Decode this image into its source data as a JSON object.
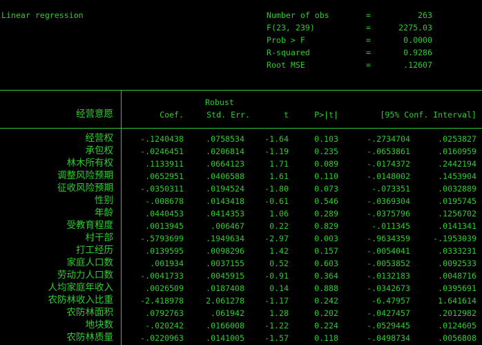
{
  "header": {
    "model_title": "Linear regression",
    "stats": [
      {
        "label": "Number of obs",
        "eq": "=",
        "value": "263"
      },
      {
        "label": "F(23, 239)",
        "eq": "=",
        "value": "2275.03"
      },
      {
        "label": "Prob > F",
        "eq": "=",
        "value": "0.0000"
      },
      {
        "label": "R-squared",
        "eq": "=",
        "value": "0.9286"
      },
      {
        "label": "Root MSE",
        "eq": "=",
        "value": ".12607"
      }
    ]
  },
  "table": {
    "robust_label": "Robust",
    "depvar": "经营意愿",
    "columns": [
      "Coef.",
      "Std. Err.",
      "t",
      "P>|t|",
      "[95% Conf. Interval]"
    ],
    "rows": [
      {
        "name": "经营权",
        "coef": "-.1240438",
        "se": ".0758534",
        "t": "-1.64",
        "p": "0.103",
        "lo": "-.2734704",
        "hi": ".0253827"
      },
      {
        "name": "承包权",
        "coef": "-.0246451",
        "se": ".0206814",
        "t": "-1.19",
        "p": "0.235",
        "lo": "-.0653861",
        "hi": ".0160959"
      },
      {
        "name": "林木所有权",
        "coef": ".1133911",
        "se": ".0664123",
        "t": "1.71",
        "p": "0.089",
        "lo": "-.0174372",
        "hi": ".2442194"
      },
      {
        "name": "调整风险预期",
        "coef": ".0652951",
        "se": ".0406588",
        "t": "1.61",
        "p": "0.110",
        "lo": "-.0148002",
        "hi": ".1453904"
      },
      {
        "name": "征收风险预期",
        "coef": "-.0350311",
        "se": ".0194524",
        "t": "-1.80",
        "p": "0.073",
        "lo": "-.073351",
        "hi": ".0032889"
      },
      {
        "name": "性别",
        "coef": "-.008678",
        "se": ".0143418",
        "t": "-0.61",
        "p": "0.546",
        "lo": "-.0369304",
        "hi": ".0195745"
      },
      {
        "name": "年龄",
        "coef": ".0440453",
        "se": ".0414353",
        "t": "1.06",
        "p": "0.289",
        "lo": "-.0375796",
        "hi": ".1256702"
      },
      {
        "name": "受教育程度",
        "coef": ".0013945",
        "se": ".006467",
        "t": "0.22",
        "p": "0.829",
        "lo": "-.011345",
        "hi": ".0141341"
      },
      {
        "name": "村干部",
        "coef": "-.5793699",
        "se": ".1949634",
        "t": "-2.97",
        "p": "0.003",
        "lo": "-.9634359",
        "hi": "-.1953039"
      },
      {
        "name": "打工经历",
        "coef": ".0139595",
        "se": ".0098296",
        "t": "1.42",
        "p": "0.157",
        "lo": "-.0054041",
        "hi": ".0333231"
      },
      {
        "name": "家庭人口数",
        "coef": ".001934",
        "se": ".0037155",
        "t": "0.52",
        "p": "0.603",
        "lo": "-.0053852",
        "hi": ".0092533"
      },
      {
        "name": "劳动力人口数",
        "coef": "-.0041733",
        "se": ".0045915",
        "t": "-0.91",
        "p": "0.364",
        "lo": "-.0132183",
        "hi": ".0048716"
      },
      {
        "name": "人均家庭年收入",
        "coef": ".0026509",
        "se": ".0187408",
        "t": "0.14",
        "p": "0.888",
        "lo": "-.0342673",
        "hi": ".0395691"
      },
      {
        "name": "农防林收入比重",
        "coef": "-2.418978",
        "se": "2.061278",
        "t": "-1.17",
        "p": "0.242",
        "lo": "-6.47957",
        "hi": "1.641614"
      },
      {
        "name": "农防林面积",
        "coef": ".0792763",
        "se": ".061942",
        "t": "1.28",
        "p": "0.202",
        "lo": "-.0427457",
        "hi": ".2012982"
      },
      {
        "name": "地块数",
        "coef": "-.020242",
        "se": ".0166008",
        "t": "-1.22",
        "p": "0.224",
        "lo": "-.0529445",
        "hi": ".0124605"
      },
      {
        "name": "农防林质量",
        "coef": "-.0220963",
        "se": ".0141005",
        "t": "-1.57",
        "p": "0.118",
        "lo": "-.0498734",
        "hi": ".0056808"
      }
    ]
  }
}
